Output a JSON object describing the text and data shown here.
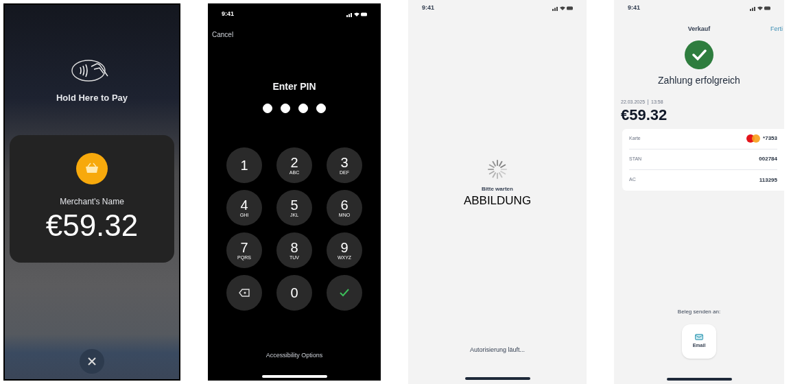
{
  "screens": [
    {
      "kind": "tap",
      "title": "Hold Here to Pay",
      "merchant": "Merchant's Name",
      "amount": "€59.32"
    },
    {
      "kind": "pin",
      "status_time": "9:41",
      "cancel": "Cancel",
      "title": "Enter PIN",
      "pin_dots": [
        {
          "filled": true
        },
        {
          "filled": true
        },
        {
          "filled": true
        },
        {
          "filled": true
        }
      ],
      "keys": [
        {
          "kind": "digit",
          "digit": "1"
        },
        {
          "kind": "digit",
          "digit": "2",
          "letters": "ABC"
        },
        {
          "kind": "digit",
          "digit": "3",
          "letters": "DEF"
        },
        {
          "kind": "digit",
          "digit": "4",
          "letters": "GHI"
        },
        {
          "kind": "digit",
          "digit": "5",
          "letters": "JKL"
        },
        {
          "kind": "digit",
          "digit": "6",
          "letters": "MNO"
        },
        {
          "kind": "digit",
          "digit": "7",
          "letters": "PQRS"
        },
        {
          "kind": "digit",
          "digit": "8",
          "letters": "TUV"
        },
        {
          "kind": "digit",
          "digit": "9",
          "letters": "WXYZ"
        },
        {
          "kind": "delete"
        },
        {
          "kind": "digit",
          "digit": "0"
        },
        {
          "kind": "confirm"
        }
      ],
      "footer": "Accessibility Options"
    },
    {
      "kind": "wait",
      "status_time": "9:41",
      "message": "Bitte warten",
      "caption": "ABBILDUNG",
      "footer": "Autorisierung läuft..."
    },
    {
      "kind": "success",
      "status_time": "9:41",
      "title": "Verkauf",
      "done": "Ferti",
      "headline": "Zahlung erfolgreich",
      "date": "22.03.2025",
      "time": "13:58",
      "amount": "€59.32",
      "details": [
        {
          "kind": "card",
          "label": "Karte",
          "value": "*7353"
        },
        {
          "kind": "text",
          "label": "STAN",
          "value": "002784"
        },
        {
          "kind": "text",
          "label": "AC",
          "value": "113295"
        }
      ],
      "send_label": "Beleg senden an:",
      "send_button": "Email"
    }
  ]
}
